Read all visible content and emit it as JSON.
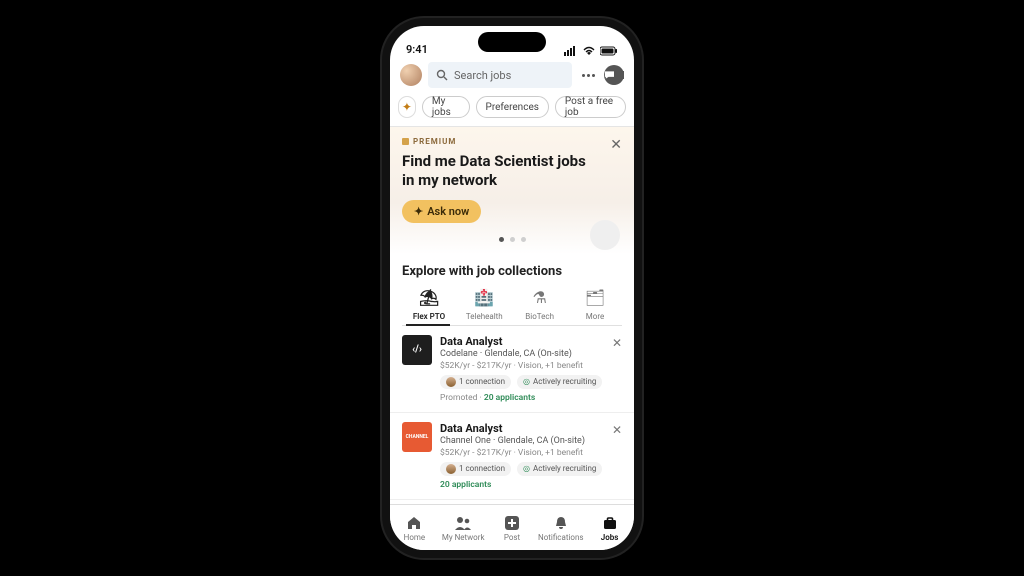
{
  "status": {
    "time": "9:41"
  },
  "search": {
    "placeholder": "Search jobs"
  },
  "nav_pills": {
    "my_jobs": "My jobs",
    "preferences": "Preferences",
    "post_job": "Post a free job"
  },
  "premium": {
    "badge": "PREMIUM",
    "headline": "Find me Data Scientist jobs in my network",
    "cta": "Ask now"
  },
  "explore": {
    "title": "Explore with job collections",
    "items": [
      {
        "label": "Flex PTO",
        "active": true
      },
      {
        "label": "Telehealth",
        "active": false
      },
      {
        "label": "BioTech",
        "active": false
      },
      {
        "label": "More",
        "active": false
      }
    ]
  },
  "jobs": [
    {
      "title": "Data Analyst",
      "company_line": "Codelane · Glendale, CA (On-site)",
      "meta": "$52K/yr - $217K/yr · Vision, +1 benefit",
      "connection": "1 connection",
      "recruiting": "Actively recruiting",
      "promoted": "Promoted",
      "applicants": "20 applicants"
    },
    {
      "title": "Data Analyst",
      "company_line": "Channel One · Glendale, CA (On-site)",
      "meta": "$52K/yr - $217K/yr · Vision, +1 benefit",
      "connection": "1 connection",
      "recruiting": "Actively recruiting",
      "promoted": "",
      "applicants": "20 applicants"
    }
  ],
  "tabbar": {
    "home": "Home",
    "network": "My Network",
    "post": "Post",
    "notifications": "Notifications",
    "jobs": "Jobs"
  }
}
